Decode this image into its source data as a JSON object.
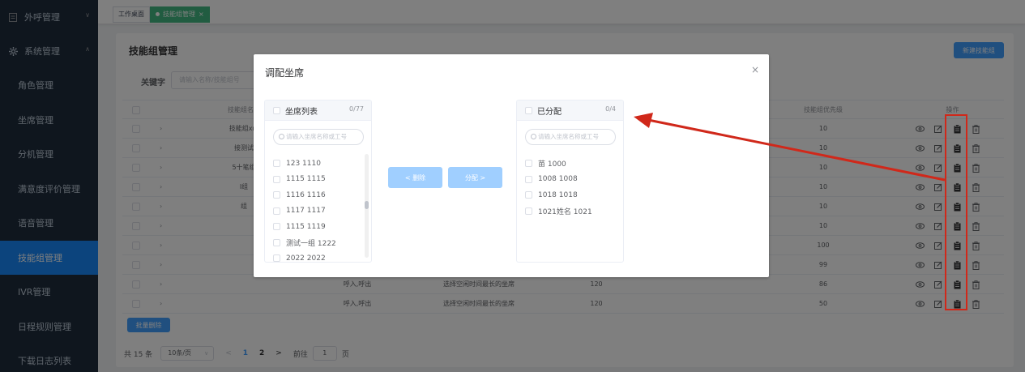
{
  "sidebar": {
    "groups": [
      {
        "label": "外呼管理",
        "icon": "document-icon",
        "arrow": "∨"
      },
      {
        "label": "系统管理",
        "icon": "gear-icon",
        "arrow": "∧"
      }
    ],
    "items": [
      {
        "label": "角色管理"
      },
      {
        "label": "坐席管理"
      },
      {
        "label": "分机管理"
      },
      {
        "label": "满意度评价管理"
      },
      {
        "label": "语音管理"
      },
      {
        "label": "技能组管理",
        "active": true
      },
      {
        "label": "IVR管理"
      },
      {
        "label": "日程规则管理"
      },
      {
        "label": "下载日志列表"
      }
    ]
  },
  "tabs": [
    {
      "label": "工作桌面"
    },
    {
      "label": "技能组管理",
      "active": true,
      "close": "×"
    }
  ],
  "page": {
    "title": "技能组管理",
    "new_button": "新建技能组",
    "keyword_label": "关键字",
    "keyword_placeholder": "请输入名称/技能组号",
    "batch_delete": "批量删除"
  },
  "table": {
    "headers": {
      "name": "技能组名称",
      "priority": "技能组优先级",
      "ops": "操作"
    },
    "rows": [
      {
        "name": "技能组xm",
        "type": "",
        "strategy": "",
        "wait": "",
        "priority": "10"
      },
      {
        "name": "接测试",
        "type": "",
        "strategy": "",
        "wait": "",
        "priority": "10"
      },
      {
        "name": "5十笔组",
        "type": "",
        "strategy": "",
        "wait": "",
        "priority": "10"
      },
      {
        "name": "I组",
        "type": "",
        "strategy": "",
        "wait": "",
        "priority": "10"
      },
      {
        "name": "组",
        "type": "",
        "strategy": "",
        "wait": "",
        "priority": "10"
      },
      {
        "name": "",
        "type": "",
        "strategy": "",
        "wait": "",
        "priority": "10"
      },
      {
        "name": "",
        "type": "",
        "strategy": "",
        "wait": "",
        "priority": "100"
      },
      {
        "name": "",
        "type": "",
        "strategy": "",
        "wait": "",
        "priority": "99"
      },
      {
        "name": "",
        "type": "呼入,呼出",
        "strategy": "选择空闲时间最长的坐席",
        "wait": "120",
        "priority": "86"
      },
      {
        "name": "",
        "type": "呼入,呼出",
        "strategy": "选择空闲时间最长的坐席",
        "wait": "120",
        "priority": "50"
      }
    ]
  },
  "pagination": {
    "total": "共 15 条",
    "page_size": "10条/页",
    "prev": "<",
    "pages": [
      "1",
      "2"
    ],
    "next": ">",
    "goto_label": "前往",
    "goto_value": "1",
    "goto_suffix": "页"
  },
  "dialog": {
    "title": "调配坐席",
    "close": "×",
    "left_panel": {
      "title": "坐席列表",
      "count": "0/77",
      "search_placeholder": "请输入坐席名称或工号",
      "items": [
        "123 1110",
        "1115 1115",
        "1116 1116",
        "1117 1117",
        "1115 1119",
        "测试一组 1222",
        "2022 2022"
      ]
    },
    "right_panel": {
      "title": "已分配",
      "count": "0/4",
      "search_placeholder": "请输入坐席名称或工号",
      "items": [
        "苗 1000",
        "1008 1008",
        "1018 1018",
        "1021姓名 1021"
      ]
    },
    "remove_button": "< 删除",
    "assign_button": "分配 >"
  },
  "colors": {
    "sidebar_bg": "#1f2d3d",
    "active": "#1989fa",
    "primary": "#409eff",
    "tab_active": "#42b983",
    "annotation": "#d0281a"
  }
}
